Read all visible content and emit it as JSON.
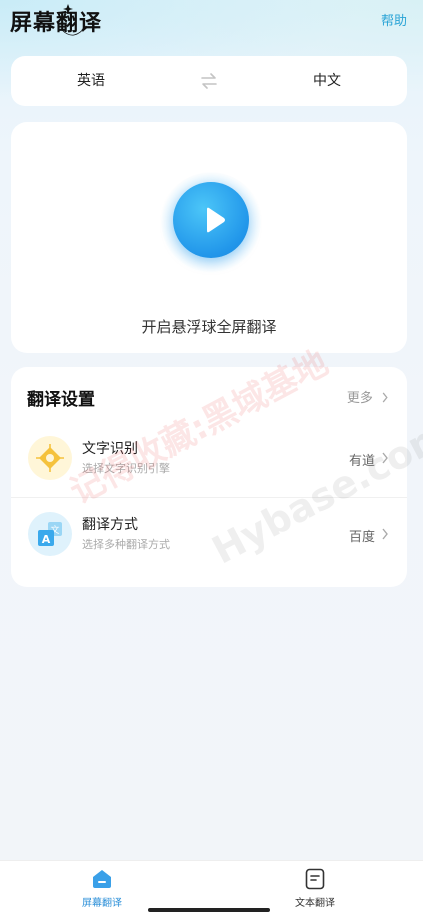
{
  "header": {
    "title": "屏幕翻译",
    "help_label": "帮助"
  },
  "language": {
    "source": "英语",
    "target": "中文",
    "swap_icon": "swap-arrows-icon"
  },
  "launch": {
    "play_icon": "play-icon",
    "label": "开启悬浮球全屏翻译"
  },
  "settings": {
    "title": "翻译设置",
    "more_label": "更多",
    "items": [
      {
        "icon": "ocr-diamond-icon",
        "title": "文字识别",
        "subtitle": "选择文字识别引擎",
        "value": "有道"
      },
      {
        "icon": "translate-az-icon",
        "title": "翻译方式",
        "subtitle": "选择多种翻译方式",
        "value": "百度"
      }
    ]
  },
  "watermark": {
    "text_cn": "记得收藏:黑域基地",
    "text_en": "Hybase.com"
  },
  "bottom_nav": {
    "items": [
      {
        "label": "屏幕翻译",
        "icon": "screen-translate-icon",
        "active": true
      },
      {
        "label": "文本翻译",
        "icon": "text-translate-icon",
        "active": false
      }
    ]
  },
  "colors": {
    "accent": "#2aa4d6",
    "play_blue": "#2196ea",
    "active_nav": "#2b8fd8"
  }
}
